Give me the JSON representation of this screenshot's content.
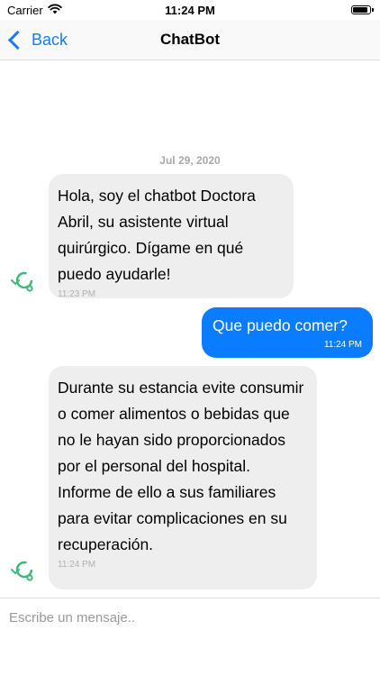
{
  "status_bar": {
    "carrier": "Carrier",
    "time": "11:24 PM",
    "battery_level": 0.95
  },
  "nav": {
    "back_label": "Back",
    "title": "ChatBot"
  },
  "chat": {
    "date_label": "Jul 29, 2020",
    "messages": [
      {
        "sender": "bot",
        "text": "Hola, soy el chatbot Doctora Abril, su asistente virtual quirúrgico. Dígame en qué puedo ayudarle!",
        "time": "11:23 PM"
      },
      {
        "sender": "user",
        "text": "Que puedo comer?",
        "time": "11:24 PM"
      },
      {
        "sender": "bot",
        "text": "Durante su estancia evite consumir o comer alimentos o bebidas que no le hayan sido proporcionados por el personal del hospital. Informe de ello a sus familiares para evitar complicaciones en su recuperación.",
        "time": "11:24 PM"
      }
    ]
  },
  "composer": {
    "placeholder": "Escribe un mensaje..",
    "value": ""
  },
  "colors": {
    "accent": "#1a7cf5",
    "user_bubble": "#0a7cff",
    "bot_bubble": "#eeeeee",
    "avatar_green": "#3cb878"
  },
  "icons": {
    "back": "chevron-left-icon",
    "wifi": "wifi-icon",
    "battery": "battery-icon",
    "bot_avatar": "bot-avatar-icon"
  }
}
